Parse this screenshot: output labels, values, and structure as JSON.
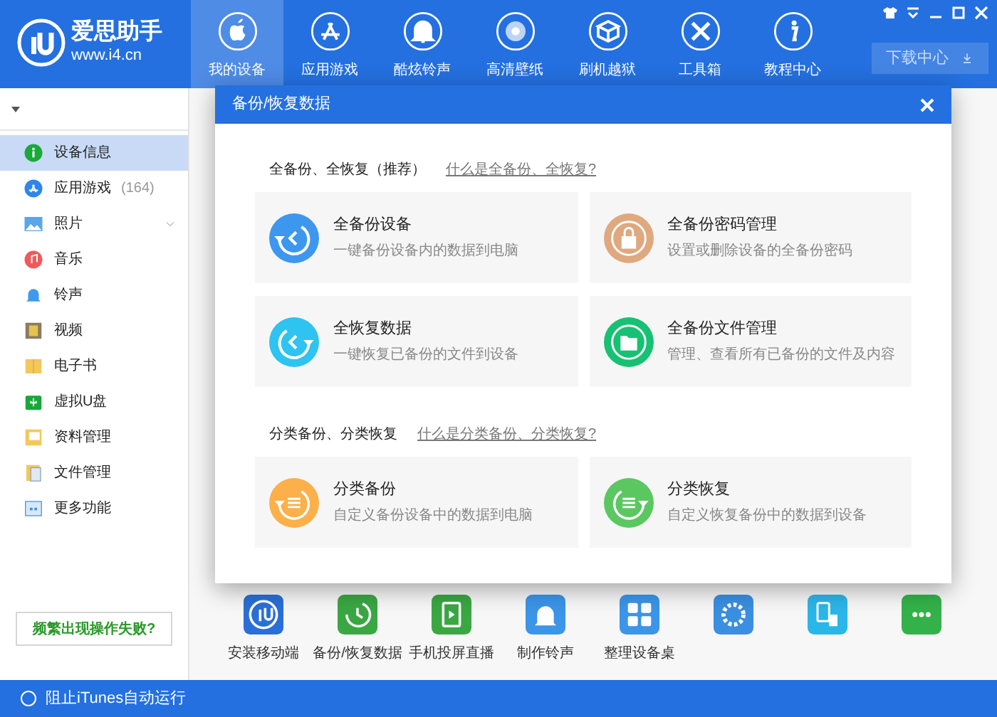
{
  "app": {
    "name": "爱思助手",
    "url": "www.i4.cn"
  },
  "nav": [
    {
      "label": "我的设备",
      "kind": "apple",
      "selected": true
    },
    {
      "label": "应用游戏",
      "kind": "appstore",
      "selected": false
    },
    {
      "label": "酷炫铃声",
      "kind": "bell",
      "selected": false
    },
    {
      "label": "高清壁纸",
      "kind": "flower",
      "selected": false
    },
    {
      "label": "刷机越狱",
      "kind": "box",
      "selected": false
    },
    {
      "label": "工具箱",
      "kind": "tools",
      "selected": false
    },
    {
      "label": "教程中心",
      "kind": "info",
      "selected": false
    }
  ],
  "download_button": "下载中心",
  "sidebar": {
    "items": [
      {
        "label": "设备信息",
        "kind": "info",
        "selected": true,
        "expandable": false
      },
      {
        "label": "应用游戏",
        "count": "(164)",
        "kind": "app",
        "selected": false,
        "expandable": false
      },
      {
        "label": "照片",
        "kind": "photo",
        "selected": false,
        "expandable": true
      },
      {
        "label": "音乐",
        "kind": "music",
        "selected": false,
        "expandable": false
      },
      {
        "label": "铃声",
        "kind": "bell",
        "selected": false,
        "expandable": false
      },
      {
        "label": "视频",
        "kind": "video",
        "selected": false,
        "expandable": false
      },
      {
        "label": "电子书",
        "kind": "book",
        "selected": false,
        "expandable": false
      },
      {
        "label": "虚拟U盘",
        "kind": "usb",
        "selected": false,
        "expandable": false
      },
      {
        "label": "资料管理",
        "kind": "notes",
        "selected": false,
        "expandable": false
      },
      {
        "label": "文件管理",
        "kind": "files",
        "selected": false,
        "expandable": false
      },
      {
        "label": "更多功能",
        "kind": "grid",
        "selected": false,
        "expandable": false
      }
    ],
    "help_button": "频繁出现操作失败?"
  },
  "dialog": {
    "title": "备份/恢复数据",
    "sections": [
      {
        "heading": "全备份、全恢复（推荐）",
        "link": "什么是全备份、全恢复?",
        "cards": [
          {
            "title": "全备份设备",
            "description": "一键备份设备内的数据到电脑",
            "kind": "backup",
            "color": "#3d97ee"
          },
          {
            "title": "全备份密码管理",
            "description": "设置或删除设备的全备份密码",
            "kind": "lock",
            "color": "#dfa87f"
          },
          {
            "title": "全恢复数据",
            "description": "一键恢复已备份的文件到设备",
            "kind": "restore",
            "color": "#2ec3f1"
          },
          {
            "title": "全备份文件管理",
            "description": "管理、查看所有已备份的文件及内容",
            "kind": "folder",
            "color": "#17c173"
          }
        ]
      },
      {
        "heading": "分类备份、分类恢复",
        "link": "什么是分类备份、分类恢复?",
        "cards": [
          {
            "title": "分类备份",
            "description": "自定义备份设备中的数据到电脑",
            "kind": "listbackup",
            "color": "#fbb04a"
          },
          {
            "title": "分类恢复",
            "description": "自定义恢复备份中的数据到设备",
            "kind": "listrestore",
            "color": "#5bc761"
          }
        ]
      }
    ]
  },
  "tools": [
    {
      "label": "安装移动端",
      "kind": "logo",
      "color": "#2a6fd8"
    },
    {
      "label": "备份/恢复数据",
      "kind": "clock",
      "color": "#3aa743"
    },
    {
      "label": "手机投屏直播",
      "kind": "play",
      "color": "#3aa743"
    },
    {
      "label": "制作铃声",
      "kind": "bell",
      "color": "#3b95e8"
    },
    {
      "label": "整理设备桌",
      "kind": "grid",
      "color": "#3b95e8"
    },
    {
      "kind": "gear",
      "color": "#3b8fe0"
    },
    {
      "kind": "transfer",
      "color": "#2bb6e8"
    },
    {
      "kind": "more",
      "color": "#34b24a"
    }
  ],
  "status_bar": "阻止iTunes自动运行"
}
